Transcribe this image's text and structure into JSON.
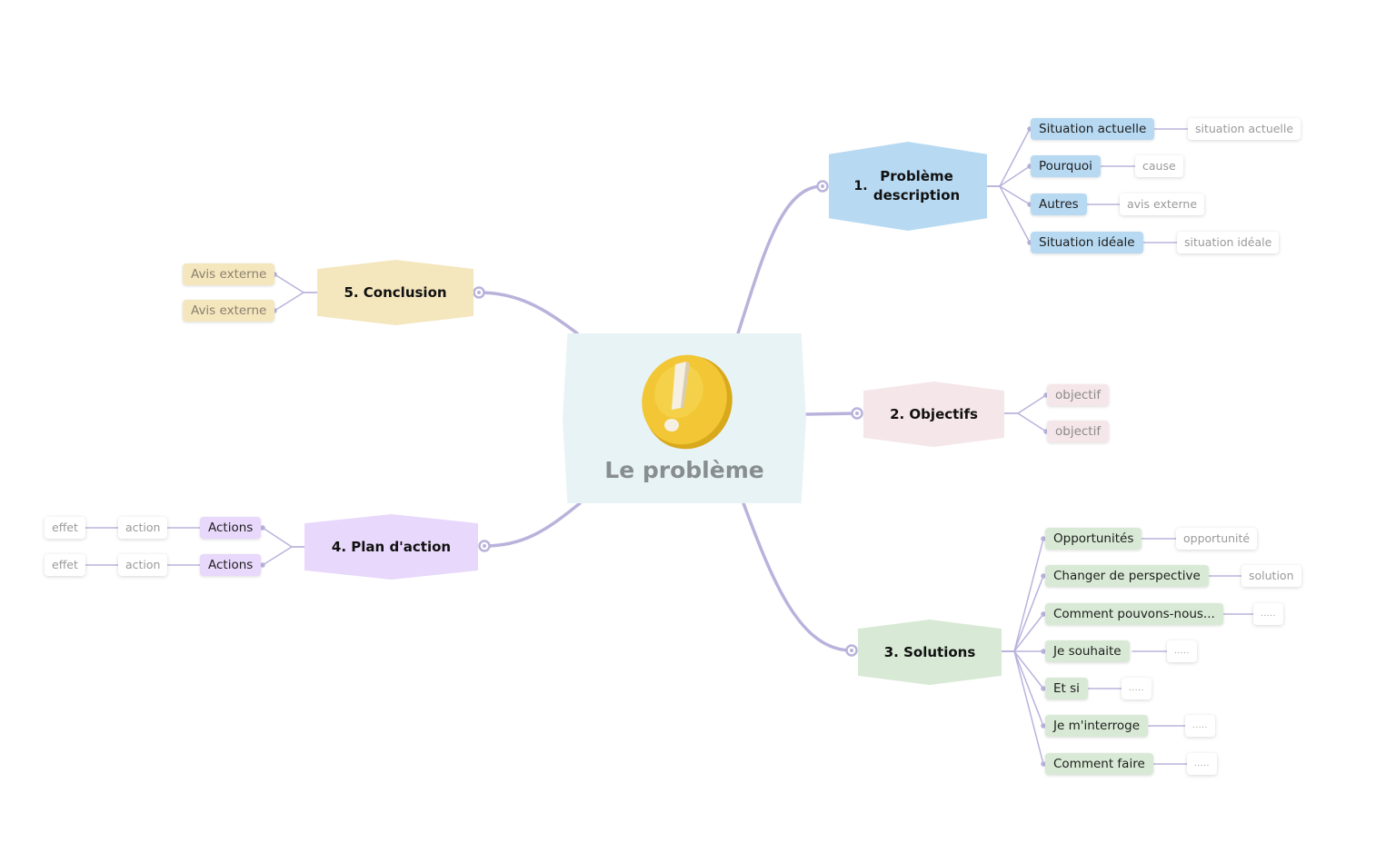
{
  "colors": {
    "link": "#b9b3dc",
    "root_bg": "#e8f3f6",
    "branch1": "#b7d9f2",
    "branch2": "#f5e6ea",
    "branch3": "#d8ead5",
    "branch4": "#e8d8fb",
    "branch5": "#f4e6bd",
    "coin": "#f2c634"
  },
  "root": {
    "title": "Le problème",
    "icon": "exclamation-coin-icon"
  },
  "branches": {
    "b1": {
      "number": "1.",
      "label": "Problème description",
      "children": [
        {
          "label": "Situation actuelle",
          "leaf": "situation actuelle"
        },
        {
          "label": "Pourquoi",
          "leaf": "cause"
        },
        {
          "label": "Autres",
          "leaf": "avis externe"
        },
        {
          "label": "Situation idéale",
          "leaf": "situation idéale"
        }
      ]
    },
    "b2": {
      "label": "2. Objectifs",
      "children": [
        {
          "label": "objectif"
        },
        {
          "label": "objectif"
        }
      ]
    },
    "b3": {
      "label": "3. Solutions",
      "children": [
        {
          "label": "Opportunités",
          "leaf": "opportunité"
        },
        {
          "label": "Changer de perspective",
          "leaf": "solution"
        },
        {
          "label": "Comment pouvons-nous...",
          "leaf": "....."
        },
        {
          "label": "Je souhaite",
          "leaf": "....."
        },
        {
          "label": "Et si",
          "leaf": "....."
        },
        {
          "label": "Je m'interroge",
          "leaf": "....."
        },
        {
          "label": "Comment faire",
          "leaf": "....."
        }
      ]
    },
    "b4": {
      "label": "4. Plan d'action",
      "children": [
        {
          "label": "Actions",
          "action": "action",
          "effect": "effet"
        },
        {
          "label": "Actions",
          "action": "action",
          "effect": "effet"
        }
      ]
    },
    "b5": {
      "label": "5. Conclusion",
      "children": [
        {
          "label": "Avis externe"
        },
        {
          "label": "Avis externe"
        }
      ]
    }
  }
}
